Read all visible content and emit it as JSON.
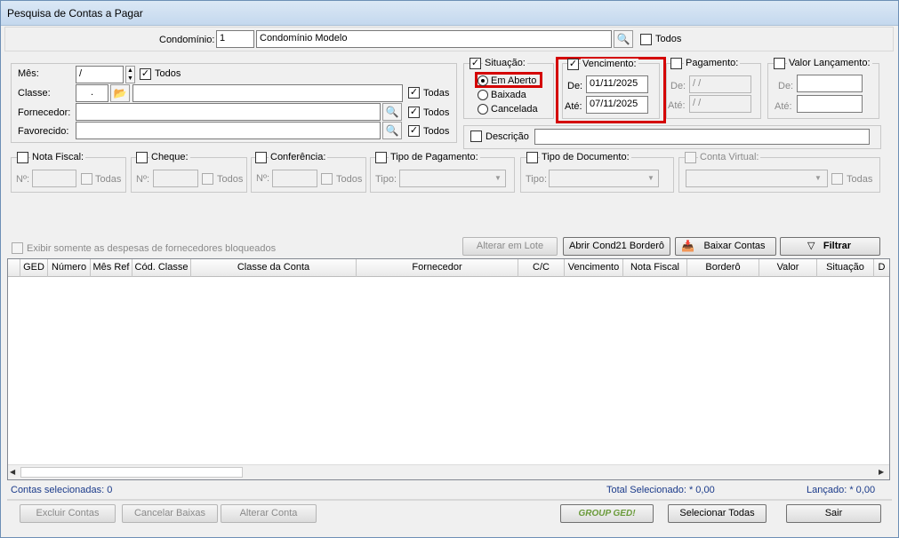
{
  "window": {
    "title": "Pesquisa de Contas a Pagar"
  },
  "condominio": {
    "label": "Condomínio:",
    "code": "1",
    "name": "Condomínio Modelo",
    "todos_label": "Todos"
  },
  "filters": {
    "mes_label": "Mês:",
    "mes_value": "/",
    "mes_todos": "Todos",
    "classe_label": "Classe:",
    "classe_value": ".",
    "classe_todas": "Todas",
    "fornecedor_label": "Fornecedor:",
    "fornecedor_todos": "Todos",
    "favorecido_label": "Favorecido:",
    "favorecido_todos": "Todos"
  },
  "situacao": {
    "label": "Situação:",
    "options": [
      "Em Aberto",
      "Baixada",
      "Cancelada"
    ],
    "selected": "Em Aberto"
  },
  "vencimento": {
    "label": "Vencimento:",
    "de_label": "De:",
    "de": "01/11/2025",
    "ate_label": "Até:",
    "ate": "07/11/2025"
  },
  "pagamento": {
    "label": "Pagamento:",
    "de_label": "De:",
    "de": " / /",
    "ate_label": "Até:",
    "ate": " / /"
  },
  "valor_lancamento": {
    "label": "Valor Lançamento:",
    "de_label": "De:",
    "ate_label": "Até:"
  },
  "descricao": {
    "label": "Descrição"
  },
  "nota_fiscal": {
    "label": "Nota Fiscal:",
    "n_label": "Nº:",
    "todas": "Todas"
  },
  "cheque": {
    "label": "Cheque:",
    "n_label": "Nº:",
    "todos": "Todos"
  },
  "conferencia": {
    "label": "Conferência:",
    "n_label": "Nº:",
    "todos": "Todos"
  },
  "tipo_pagamento": {
    "label": "Tipo de Pagamento:",
    "tipo_label": "Tipo:"
  },
  "tipo_documento": {
    "label": "Tipo de Documento:",
    "tipo_label": "Tipo:"
  },
  "conta_virtual": {
    "label": "Conta Virtual:",
    "todas": "Todas"
  },
  "bloqueados_label": "Exibir somente as despesas de fornecedores bloqueados",
  "actions": {
    "alterar_lote": "Alterar em Lote",
    "abrir_cond21": "Abrir Cond21 Borderô",
    "baixar_contas": "Baixar Contas",
    "filtrar": "Filtrar"
  },
  "grid": {
    "columns": [
      "GED",
      "Número",
      "Mês Ref",
      "Cód. Classe",
      "Classe da Conta",
      "Fornecedor",
      "C/C",
      "Vencimento",
      "Nota Fiscal",
      "Borderô",
      "Valor",
      "Situação",
      "D"
    ]
  },
  "status": {
    "selecionadas": "Contas selecionadas: 0",
    "total": "Total Selecionado: * 0,00",
    "lancado": "Lançado: * 0,00"
  },
  "footer": {
    "excluir": "Excluir Contas",
    "cancelar": "Cancelar Baixas",
    "alterar": "Alterar Conta",
    "ged_logo": "GROUP GED!",
    "selecionar": "Selecionar Todas",
    "sair": "Sair"
  }
}
